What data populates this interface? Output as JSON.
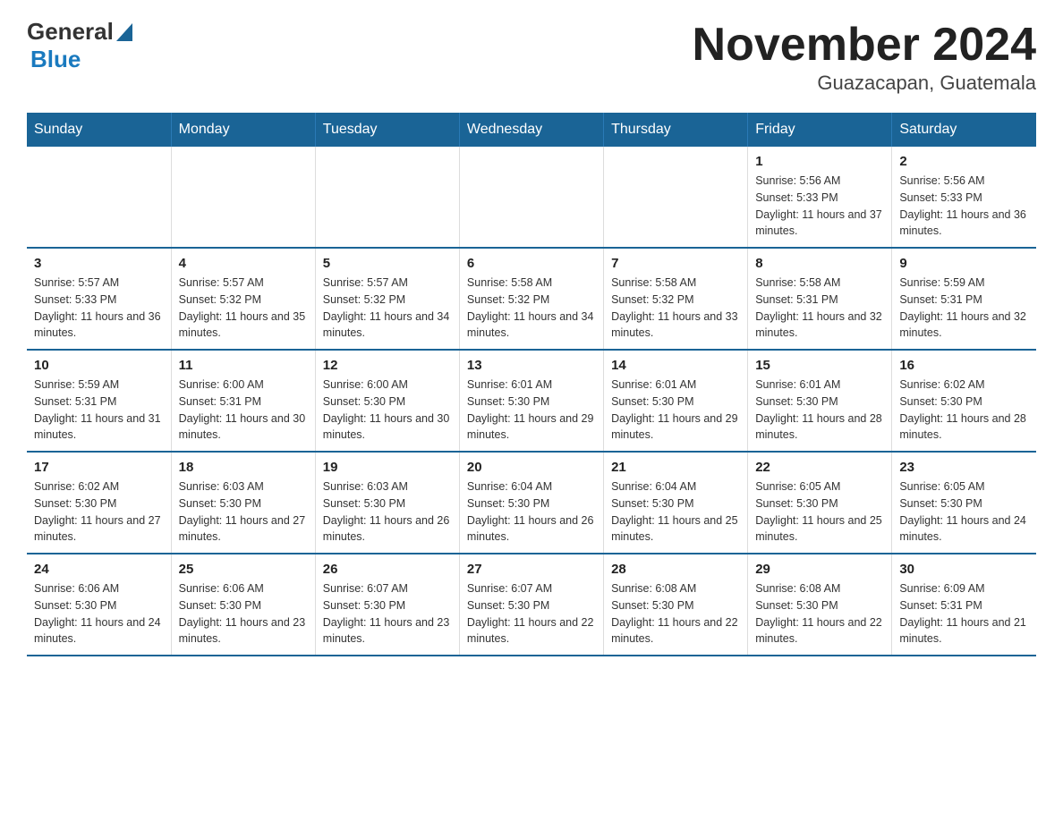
{
  "logo": {
    "general": "General",
    "blue": "Blue",
    "triangle_color": "#1a6496"
  },
  "title": "November 2024",
  "subtitle": "Guazacapan, Guatemala",
  "days_of_week": [
    "Sunday",
    "Monday",
    "Tuesday",
    "Wednesday",
    "Thursday",
    "Friday",
    "Saturday"
  ],
  "weeks": [
    [
      {
        "day": "",
        "info": ""
      },
      {
        "day": "",
        "info": ""
      },
      {
        "day": "",
        "info": ""
      },
      {
        "day": "",
        "info": ""
      },
      {
        "day": "",
        "info": ""
      },
      {
        "day": "1",
        "info": "Sunrise: 5:56 AM\nSunset: 5:33 PM\nDaylight: 11 hours and 37 minutes."
      },
      {
        "day": "2",
        "info": "Sunrise: 5:56 AM\nSunset: 5:33 PM\nDaylight: 11 hours and 36 minutes."
      }
    ],
    [
      {
        "day": "3",
        "info": "Sunrise: 5:57 AM\nSunset: 5:33 PM\nDaylight: 11 hours and 36 minutes."
      },
      {
        "day": "4",
        "info": "Sunrise: 5:57 AM\nSunset: 5:32 PM\nDaylight: 11 hours and 35 minutes."
      },
      {
        "day": "5",
        "info": "Sunrise: 5:57 AM\nSunset: 5:32 PM\nDaylight: 11 hours and 34 minutes."
      },
      {
        "day": "6",
        "info": "Sunrise: 5:58 AM\nSunset: 5:32 PM\nDaylight: 11 hours and 34 minutes."
      },
      {
        "day": "7",
        "info": "Sunrise: 5:58 AM\nSunset: 5:32 PM\nDaylight: 11 hours and 33 minutes."
      },
      {
        "day": "8",
        "info": "Sunrise: 5:58 AM\nSunset: 5:31 PM\nDaylight: 11 hours and 32 minutes."
      },
      {
        "day": "9",
        "info": "Sunrise: 5:59 AM\nSunset: 5:31 PM\nDaylight: 11 hours and 32 minutes."
      }
    ],
    [
      {
        "day": "10",
        "info": "Sunrise: 5:59 AM\nSunset: 5:31 PM\nDaylight: 11 hours and 31 minutes."
      },
      {
        "day": "11",
        "info": "Sunrise: 6:00 AM\nSunset: 5:31 PM\nDaylight: 11 hours and 30 minutes."
      },
      {
        "day": "12",
        "info": "Sunrise: 6:00 AM\nSunset: 5:30 PM\nDaylight: 11 hours and 30 minutes."
      },
      {
        "day": "13",
        "info": "Sunrise: 6:01 AM\nSunset: 5:30 PM\nDaylight: 11 hours and 29 minutes."
      },
      {
        "day": "14",
        "info": "Sunrise: 6:01 AM\nSunset: 5:30 PM\nDaylight: 11 hours and 29 minutes."
      },
      {
        "day": "15",
        "info": "Sunrise: 6:01 AM\nSunset: 5:30 PM\nDaylight: 11 hours and 28 minutes."
      },
      {
        "day": "16",
        "info": "Sunrise: 6:02 AM\nSunset: 5:30 PM\nDaylight: 11 hours and 28 minutes."
      }
    ],
    [
      {
        "day": "17",
        "info": "Sunrise: 6:02 AM\nSunset: 5:30 PM\nDaylight: 11 hours and 27 minutes."
      },
      {
        "day": "18",
        "info": "Sunrise: 6:03 AM\nSunset: 5:30 PM\nDaylight: 11 hours and 27 minutes."
      },
      {
        "day": "19",
        "info": "Sunrise: 6:03 AM\nSunset: 5:30 PM\nDaylight: 11 hours and 26 minutes."
      },
      {
        "day": "20",
        "info": "Sunrise: 6:04 AM\nSunset: 5:30 PM\nDaylight: 11 hours and 26 minutes."
      },
      {
        "day": "21",
        "info": "Sunrise: 6:04 AM\nSunset: 5:30 PM\nDaylight: 11 hours and 25 minutes."
      },
      {
        "day": "22",
        "info": "Sunrise: 6:05 AM\nSunset: 5:30 PM\nDaylight: 11 hours and 25 minutes."
      },
      {
        "day": "23",
        "info": "Sunrise: 6:05 AM\nSunset: 5:30 PM\nDaylight: 11 hours and 24 minutes."
      }
    ],
    [
      {
        "day": "24",
        "info": "Sunrise: 6:06 AM\nSunset: 5:30 PM\nDaylight: 11 hours and 24 minutes."
      },
      {
        "day": "25",
        "info": "Sunrise: 6:06 AM\nSunset: 5:30 PM\nDaylight: 11 hours and 23 minutes."
      },
      {
        "day": "26",
        "info": "Sunrise: 6:07 AM\nSunset: 5:30 PM\nDaylight: 11 hours and 23 minutes."
      },
      {
        "day": "27",
        "info": "Sunrise: 6:07 AM\nSunset: 5:30 PM\nDaylight: 11 hours and 22 minutes."
      },
      {
        "day": "28",
        "info": "Sunrise: 6:08 AM\nSunset: 5:30 PM\nDaylight: 11 hours and 22 minutes."
      },
      {
        "day": "29",
        "info": "Sunrise: 6:08 AM\nSunset: 5:30 PM\nDaylight: 11 hours and 22 minutes."
      },
      {
        "day": "30",
        "info": "Sunrise: 6:09 AM\nSunset: 5:31 PM\nDaylight: 11 hours and 21 minutes."
      }
    ]
  ]
}
